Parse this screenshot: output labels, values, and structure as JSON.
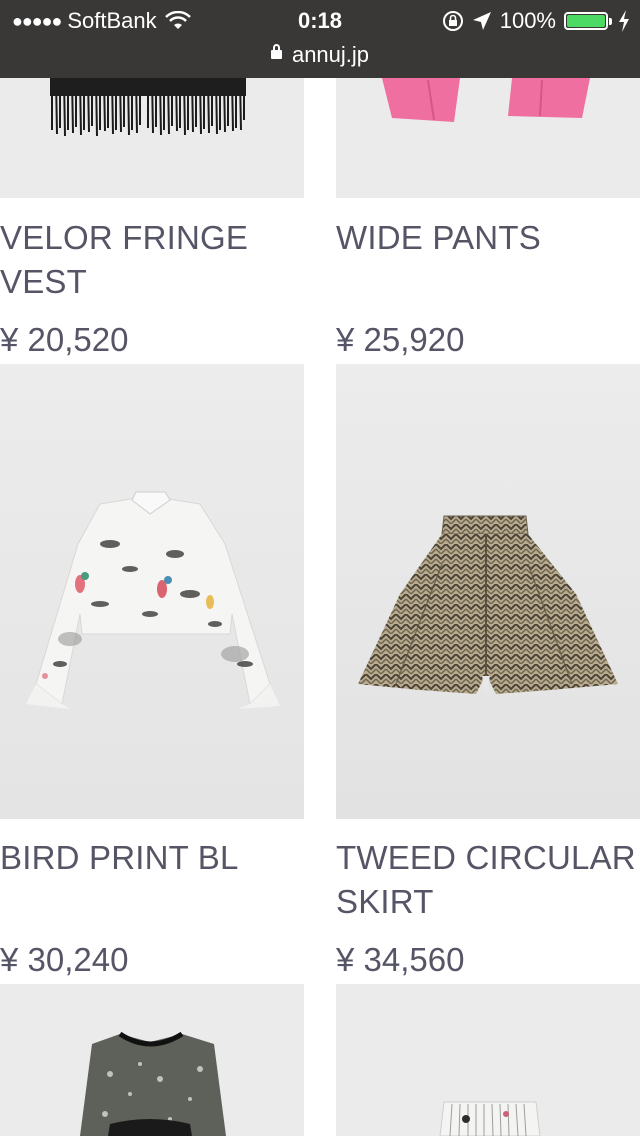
{
  "status_bar": {
    "signal_dots": "●●●●●",
    "carrier": "SoftBank",
    "time": "0:18",
    "battery": "100%",
    "url": "annuj.jp",
    "icons": [
      "wifi-icon",
      "rotation-lock-icon",
      "location-arrow-icon",
      "battery-icon",
      "charging-bolt-icon",
      "lock-icon"
    ]
  },
  "products": [
    {
      "name": "VELOR FRINGE VEST",
      "price": "¥ 20,520",
      "image": "black-fringe-vest"
    },
    {
      "name": "WIDE PANTS",
      "price": "¥ 25,920",
      "image": "pink-wide-pants"
    },
    {
      "name": "BIRD PRINT BL",
      "price": "¥ 30,240",
      "image": "bird-print-blouse"
    },
    {
      "name": "TWEED CIRCULAR SKIRT",
      "price": "¥ 34,560",
      "image": "tweed-skirt"
    }
  ],
  "colors": {
    "text": "#555566",
    "photo_bg": "#ececec",
    "battery": "#4cd964"
  }
}
